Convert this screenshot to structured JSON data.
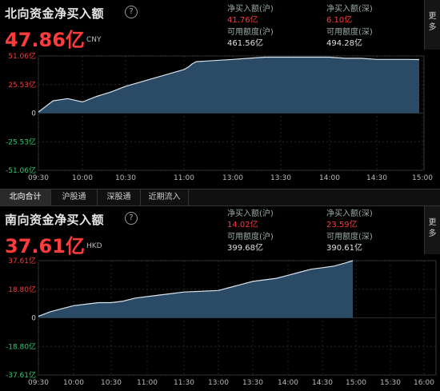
{
  "north": {
    "title": "北向资金净买入额",
    "help_icon": "?",
    "big_value": "47.86亿",
    "unit": "CNY",
    "stats": [
      {
        "label": "净买入额(沪)",
        "value": "41.76亿",
        "color": "red"
      },
      {
        "label": "净买入额(深)",
        "value": "6.10亿",
        "color": "red"
      },
      {
        "label": "可用额度(沪)",
        "value": "461.56亿",
        "color": "white"
      },
      {
        "label": "可用额度(深)",
        "value": "494.28亿",
        "color": "white"
      }
    ],
    "more": "更多",
    "y_ticks": [
      "51.06亿",
      "25.53亿",
      "0",
      "-25.53亿",
      "-51.06亿"
    ],
    "x_ticks": [
      "09:30",
      "10:00",
      "10:30",
      "11:00",
      "13:00",
      "13:30",
      "14:00",
      "14:30",
      "15:00"
    ]
  },
  "tabs": [
    "北向合计",
    "沪股通",
    "深股通",
    "近期流入"
  ],
  "south": {
    "title": "南向资金净买入额",
    "help_icon": "?",
    "big_value": "37.61亿",
    "unit": "HKD",
    "stats": [
      {
        "label": "净买入额(沪)",
        "value": "14.02亿",
        "color": "red"
      },
      {
        "label": "净买入额(深)",
        "value": "23.59亿",
        "color": "red"
      },
      {
        "label": "可用额度(沪)",
        "value": "399.68亿",
        "color": "white"
      },
      {
        "label": "可用额度(深)",
        "value": "390.61亿",
        "color": "white"
      }
    ],
    "more": "更多",
    "y_ticks": [
      "37.61亿",
      "18.80亿",
      "0",
      "-18.80亿",
      "-37.61亿"
    ],
    "x_ticks": [
      "09:30",
      "10:00",
      "10:30",
      "11:00",
      "11:30",
      "13:00",
      "13:30",
      "14:00",
      "14:30",
      "15:00",
      "15:30",
      "16:00"
    ]
  },
  "colors": {
    "red": "#ff3b3b",
    "green": "#2ecc71",
    "area": "#2b4a66",
    "line": "#d8e4ee"
  },
  "chart_data": [
    {
      "type": "area",
      "ylim": [
        -51.06,
        51.06
      ],
      "x": [
        "09:30",
        "09:40",
        "09:50",
        "10:00",
        "10:10",
        "10:20",
        "10:30",
        "10:40",
        "10:50",
        "11:00",
        "11:10",
        "11:20",
        "11:30",
        "13:00",
        "13:10",
        "13:20",
        "13:30",
        "13:40",
        "13:50",
        "14:00",
        "14:10",
        "14:20",
        "14:30",
        "14:40",
        "14:50",
        "15:00"
      ],
      "values": [
        1,
        11,
        13,
        10,
        15,
        19,
        24,
        29,
        34,
        39,
        41,
        44,
        46,
        48,
        49,
        50,
        50,
        50,
        50,
        50,
        49,
        49,
        48,
        48,
        48,
        47.86
      ]
    },
    {
      "type": "area",
      "ylim": [
        -37.61,
        37.61
      ],
      "x": [
        "09:30",
        "09:40",
        "09:50",
        "10:00",
        "10:10",
        "10:20",
        "10:30",
        "10:40",
        "10:50",
        "11:00",
        "11:10",
        "11:20",
        "11:30",
        "13:00",
        "13:10",
        "13:20",
        "13:30",
        "13:40",
        "13:50",
        "14:00",
        "14:10",
        "14:20",
        "14:30",
        "14:40",
        "14:50",
        "15:00"
      ],
      "values": [
        1,
        4,
        6,
        8,
        9,
        10,
        10,
        11,
        13,
        14,
        15,
        16,
        17,
        18,
        20,
        22,
        24,
        25,
        26,
        28,
        30,
        32,
        33,
        34,
        36,
        37.61
      ]
    }
  ]
}
